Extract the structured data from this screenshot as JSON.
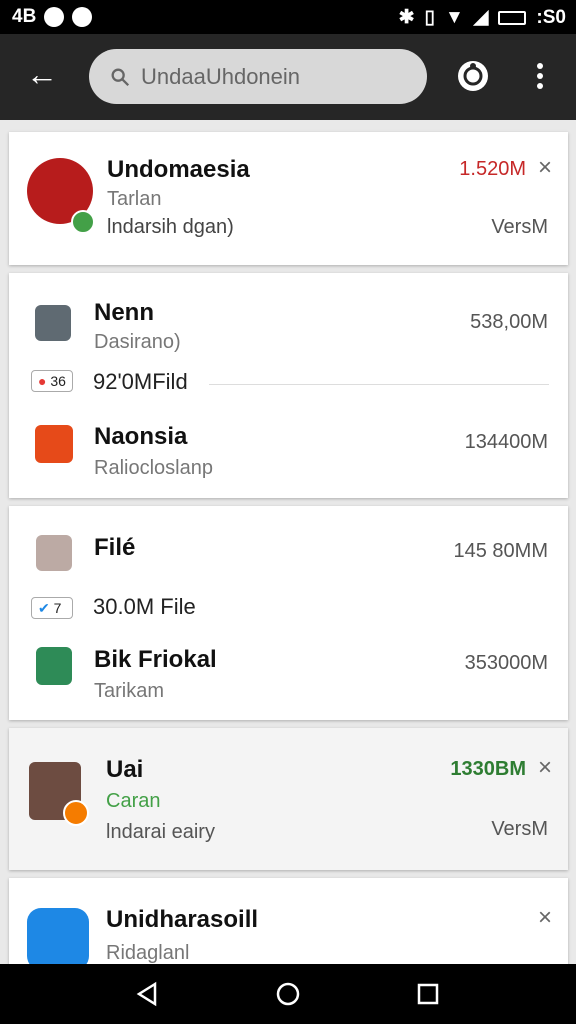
{
  "status_bar": {
    "left_text": "4B",
    "right_text": ":S0"
  },
  "search": {
    "text": "UndaaUhdonein"
  },
  "cards": [
    {
      "title": "Undomaesia",
      "subtitle": "Tarlan",
      "detail": "lndarsih dgan)",
      "size": "1.520M",
      "version": "VersM",
      "size_color": "#c62828"
    },
    {
      "title": "Nenn",
      "subtitle": "Dasirano)",
      "size": "538,00M"
    },
    {
      "badge": "36",
      "text": "92'0MFild"
    },
    {
      "title": "Naonsia",
      "subtitle": "Raliocloslanp",
      "size": "134400M"
    },
    {
      "title": "Filé",
      "size": "145 80MM"
    },
    {
      "badge": "7",
      "text": "30.0M File"
    },
    {
      "title": "Bik Friokal",
      "subtitle": "Tarikam",
      "size": "353000M"
    },
    {
      "title": "Uai",
      "subtitle": "Caran",
      "detail": "lndarai eairy",
      "size": "1330BM",
      "version": "VersM",
      "size_color": "#2e7d32"
    },
    {
      "title": "Unidharasoill",
      "subtitle": "Ridaglanl"
    }
  ],
  "icons": [
    "back-arrow-icon",
    "search-icon",
    "sync-icon",
    "more-vert-icon",
    "close-icon",
    "nav-back-icon",
    "nav-home-icon",
    "nav-recents-icon"
  ]
}
